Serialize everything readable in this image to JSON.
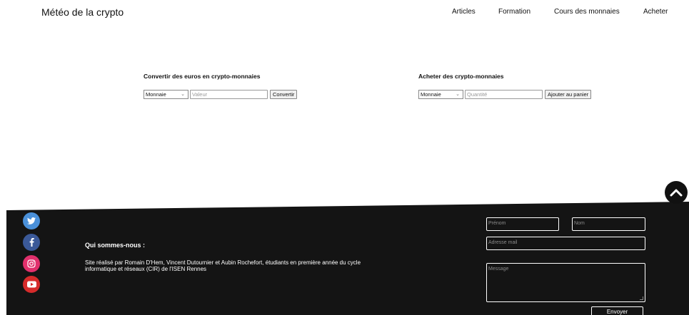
{
  "header": {
    "site_title": "Météo de la crypto",
    "nav": [
      "Articles",
      "Formation",
      "Cours des monnaies",
      "Acheter"
    ]
  },
  "convert_form": {
    "title": "Convertir des euros en crypto-monnaies",
    "select_value": "Monnaie",
    "input_placeholder": "Valeur",
    "button_label": "Convertir"
  },
  "buy_form": {
    "title": "Acheter des crypto-monnaies",
    "select_value": "Monnaie",
    "input_placeholder": "Quantité",
    "button_label": "Ajouter au panier"
  },
  "footer": {
    "social": [
      "twitter-icon",
      "facebook-icon",
      "instagram-icon",
      "youtube-icon"
    ],
    "about_title": "Qui sommes-nous :",
    "about_text": "Site réalisé par Romain D'Hem, Vincent Dutournier et Aubin Rochefort, étudiants en première année du cycle informatique et réseaux (CIR) de l'ISEN Rennes",
    "contact": {
      "first_name_placeholder": "Prénom",
      "last_name_placeholder": "Nom",
      "email_placeholder": "Adresse mail",
      "message_placeholder": "Message",
      "send_label": "Envoyer"
    }
  },
  "colors": {
    "footer_bg": "#141414",
    "twitter": "#4a90d9",
    "facebook": "#3b5998",
    "instagram": "#e1306c",
    "youtube": "#d62b2b"
  }
}
